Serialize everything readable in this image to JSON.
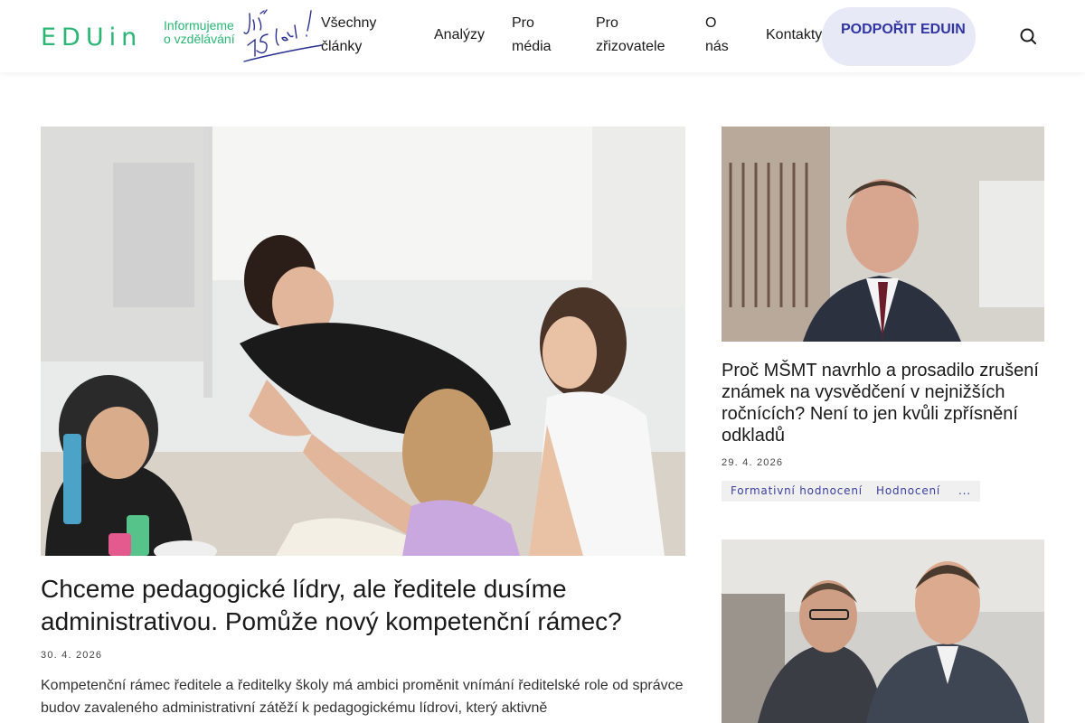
{
  "header": {
    "logo_text": "EDUin",
    "tagline": "Informujeme o vzdělávání",
    "anniversary": "již 15 let!",
    "nav": [
      {
        "label": "Všechny články"
      },
      {
        "label": "Analýzy"
      },
      {
        "label": "Pro média"
      },
      {
        "label": "Pro zřizovatele"
      },
      {
        "label": "O nás"
      },
      {
        "label": "Kontakty"
      }
    ],
    "support_button": "PODPOŘIT EDUIN",
    "search_icon": "search-icon"
  },
  "hero": {
    "title": "Chceme pedagogické lídry, ale ředitele dusíme administrativou. Pomůže nový kompetenční rámec?",
    "date": "30. 4. 2026",
    "excerpt": "Kompetenční rámec ředitele a ředitelky školy má ambici proměnit vnímání ředitelské role od správce budov zavaleného administrativní zátěží k pedagogickému lídrovi, který aktivně"
  },
  "side": [
    {
      "title": "Proč MŠMT navrhlo a prosadilo zrušení známek na vysvědčení v nejnižších ročnících? Není to jen kvůli zpřísnění odkladů",
      "date": "29. 4. 2026",
      "tags": [
        "Formativní hodnocení",
        "Hodnocení",
        "..."
      ]
    }
  ],
  "colors": {
    "brand_green": "#2bb673",
    "button_bg": "#e7e9f7",
    "button_text": "#3135a3",
    "tag_text": "#3a3f9b",
    "anniversary_blue": "#2a2f8f"
  }
}
